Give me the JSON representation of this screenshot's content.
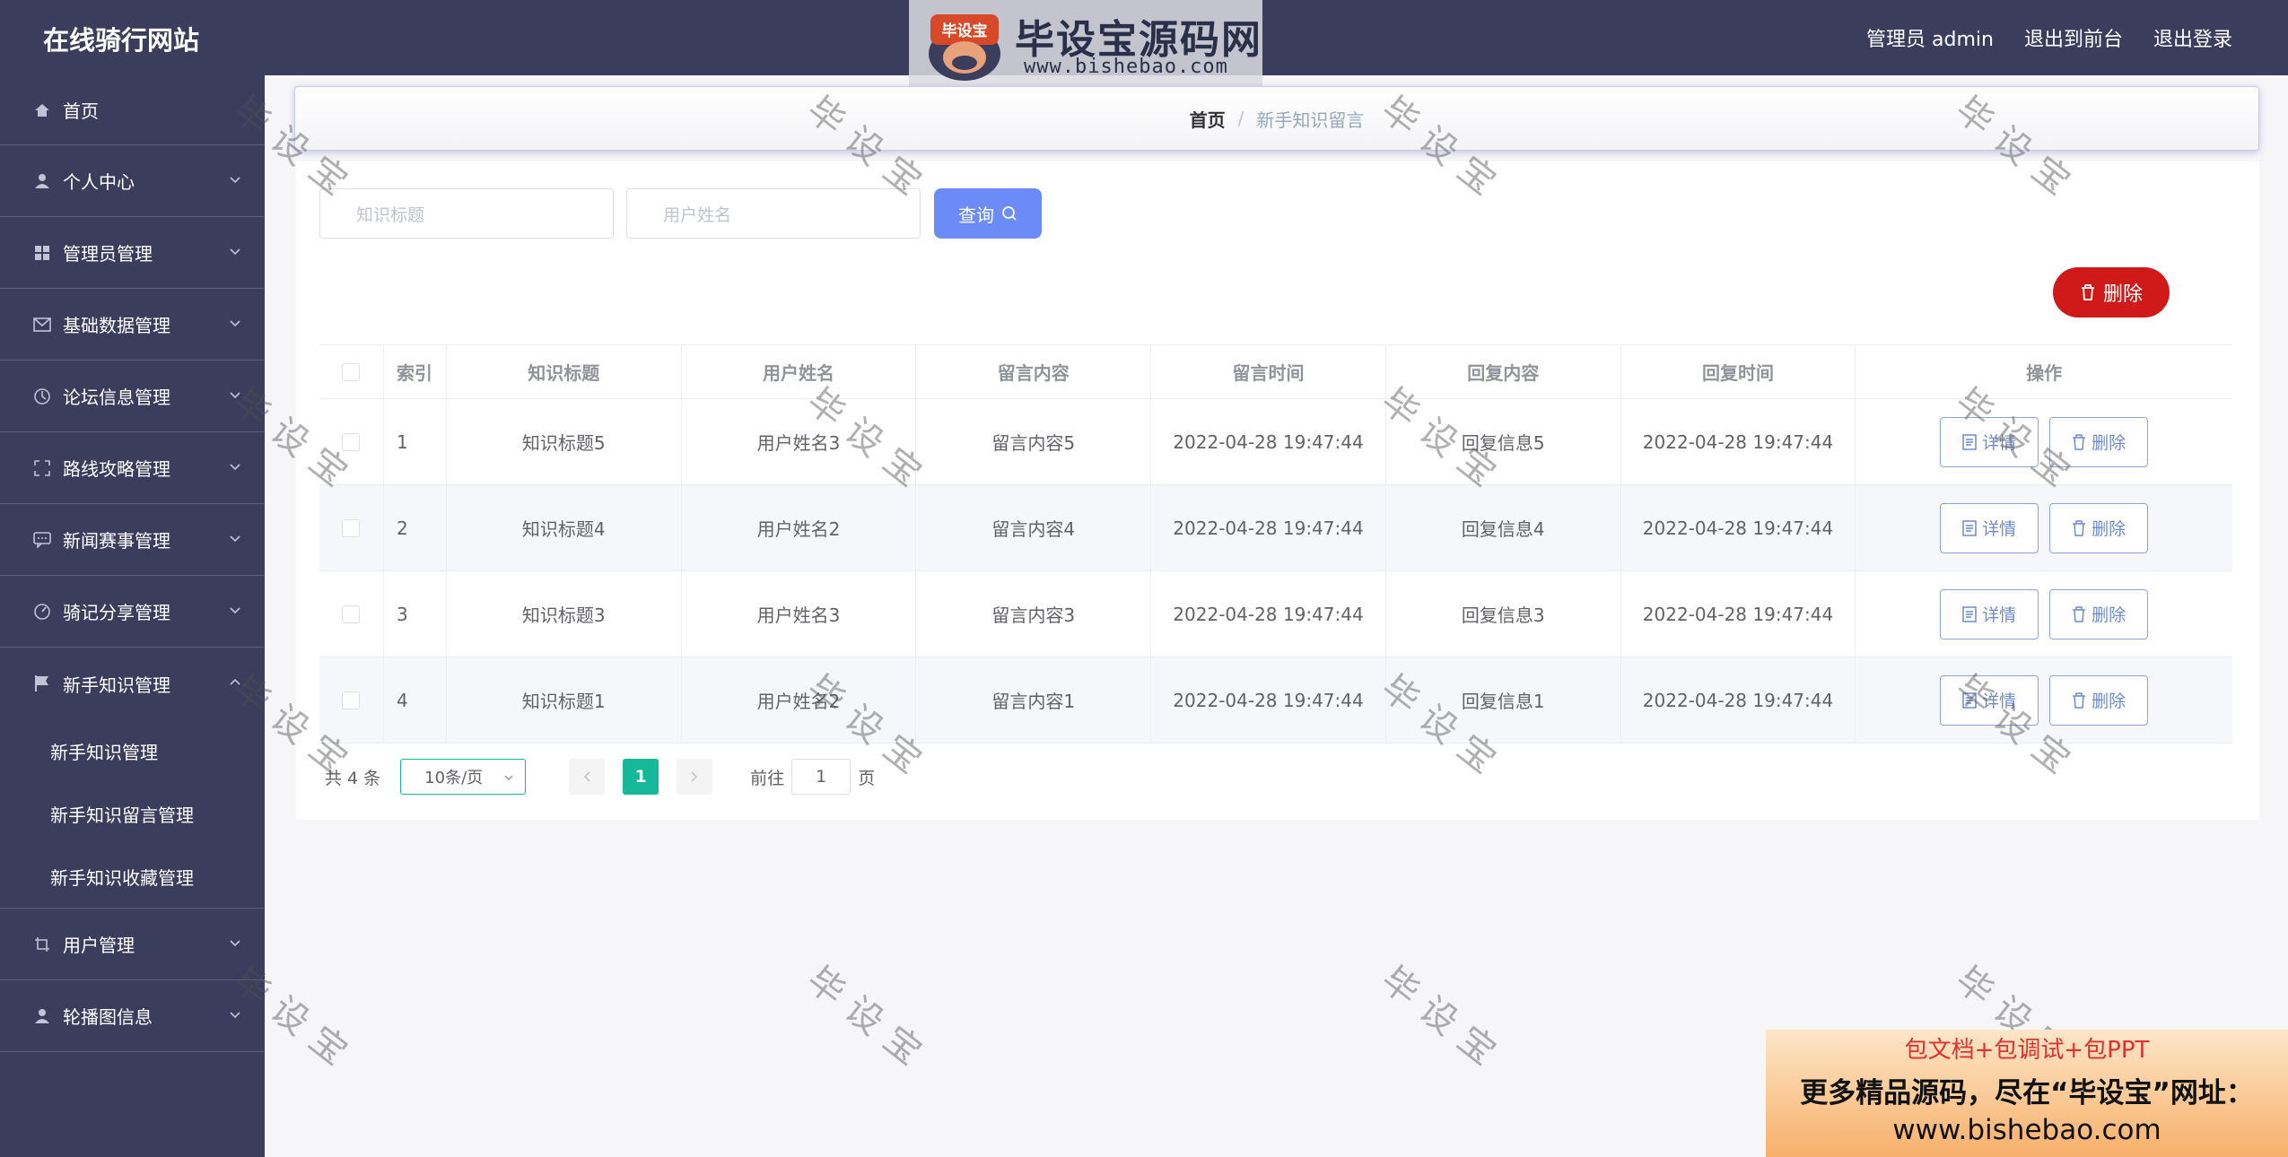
{
  "header": {
    "site_title": "在线骑行网站",
    "admin_label": "管理员 admin",
    "front_link": "退出到前台",
    "logout_link": "退出登录"
  },
  "logo": {
    "badge_text": "毕设宝",
    "title": "毕设宝源码网",
    "url": "www.bishebao.com"
  },
  "sidebar": {
    "items": [
      {
        "label": "首页",
        "icon": "home-icon"
      },
      {
        "label": "个人中心",
        "icon": "user-icon"
      },
      {
        "label": "管理员管理",
        "icon": "grid-icon"
      },
      {
        "label": "基础数据管理",
        "icon": "mail-icon"
      },
      {
        "label": "论坛信息管理",
        "icon": "compass-icon"
      },
      {
        "label": "路线攻略管理",
        "icon": "fullscreen-icon"
      },
      {
        "label": "新闻赛事管理",
        "icon": "chat-icon"
      },
      {
        "label": "骑记分享管理",
        "icon": "speed-icon"
      },
      {
        "label": "新手知识管理",
        "icon": "flag-icon"
      },
      {
        "label": "用户管理",
        "icon": "crop-icon"
      },
      {
        "label": "轮播图信息",
        "icon": "user-icon"
      }
    ],
    "submenu": [
      "新手知识管理",
      "新手知识留言管理",
      "新手知识收藏管理"
    ]
  },
  "breadcrumb": {
    "home": "首页",
    "separator": "/",
    "current": "新手知识留言"
  },
  "search": {
    "title_placeholder": "知识标题",
    "user_placeholder": "用户姓名",
    "query_label": "查询"
  },
  "toolbar": {
    "delete_label": "删除"
  },
  "table": {
    "headers": [
      "索引",
      "知识标题",
      "用户姓名",
      "留言内容",
      "留言时间",
      "回复内容",
      "回复时间",
      "操作"
    ],
    "rows": [
      [
        "1",
        "知识标题5",
        "用户姓名3",
        "留言内容5",
        "2022-04-28 19:47:44",
        "回复信息5",
        "2022-04-28 19:47:44"
      ],
      [
        "2",
        "知识标题4",
        "用户姓名2",
        "留言内容4",
        "2022-04-28 19:47:44",
        "回复信息4",
        "2022-04-28 19:47:44"
      ],
      [
        "3",
        "知识标题3",
        "用户姓名3",
        "留言内容3",
        "2022-04-28 19:47:44",
        "回复信息3",
        "2022-04-28 19:47:44"
      ],
      [
        "4",
        "知识标题1",
        "用户姓名2",
        "留言内容1",
        "2022-04-28 19:47:44",
        "回复信息1",
        "2022-04-28 19:47:44"
      ]
    ],
    "detail_label": "详情",
    "delete_label": "删除"
  },
  "pager": {
    "total": "共 4 条",
    "page_size": "10条/页",
    "current_page": "1",
    "goto_label": "前往",
    "goto_value": "1",
    "page_unit": "页"
  },
  "watermark": "毕设宝",
  "ad": {
    "line1": "包文档+包调试+包PPT",
    "line2": "更多精品源码，尽在“毕设宝”网址：",
    "line3": "www.bishebao.com"
  },
  "colors": {
    "sidebar_bg": "#3a3d5c",
    "query_button": "#6b8cf7",
    "delete_button": "#d01a1a",
    "pager_active": "#16b89a"
  }
}
